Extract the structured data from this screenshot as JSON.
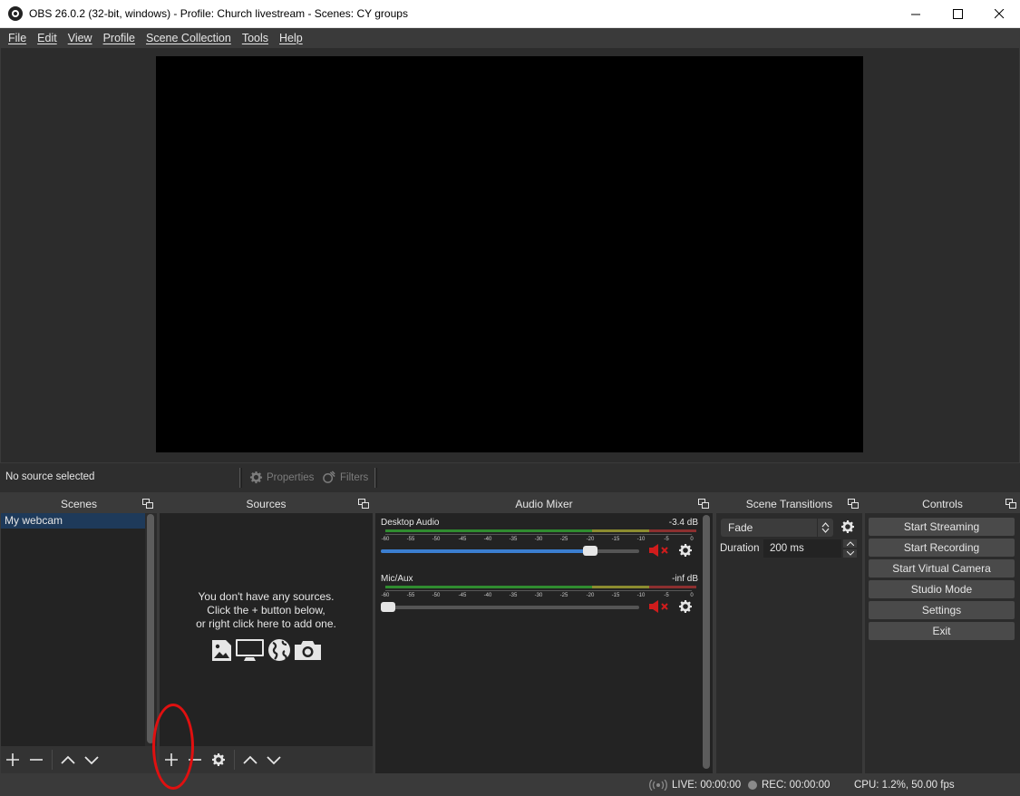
{
  "window": {
    "title": "OBS 26.0.2 (32-bit, windows) - Profile: Church livestream - Scenes: CY groups",
    "minimize": "—",
    "maximize": "☐",
    "close": "✕"
  },
  "menu": [
    "File",
    "Edit",
    "View",
    "Profile",
    "Scene Collection",
    "Tools",
    "Help"
  ],
  "source_bar": {
    "status": "No source selected",
    "properties": "Properties",
    "filters": "Filters"
  },
  "scenes": {
    "title": "Scenes",
    "items": [
      "My webcam"
    ]
  },
  "sources": {
    "title": "Sources",
    "empty_line1": "You don't have any sources.",
    "empty_line2": "Click the + button below,",
    "empty_line3": "or right click here to add one."
  },
  "mixer": {
    "title": "Audio Mixer",
    "ticks": [
      "-60",
      "-55",
      "-50",
      "-45",
      "-40",
      "-35",
      "-30",
      "-25",
      "-20",
      "-15",
      "-10",
      "-5",
      "0"
    ],
    "channels": [
      {
        "name": "Desktop Audio",
        "db": "-3.4 dB",
        "volume": 0.83
      },
      {
        "name": "Mic/Aux",
        "db": "-inf dB",
        "volume": 0.0
      }
    ]
  },
  "transitions": {
    "title": "Scene Transitions",
    "selected": "Fade",
    "duration_label": "Duration",
    "duration_value": "200 ms"
  },
  "controls": {
    "title": "Controls",
    "buttons": [
      "Start Streaming",
      "Start Recording",
      "Start Virtual Camera",
      "Studio Mode",
      "Settings",
      "Exit"
    ]
  },
  "status": {
    "live": "LIVE: 00:00:00",
    "rec": "REC: 00:00:00",
    "cpu": "CPU: 1.2%, 50.00 fps"
  },
  "colors": {
    "accent": "#3b7ed0",
    "muted": "#d01c1c",
    "annotation": "#e01010"
  }
}
